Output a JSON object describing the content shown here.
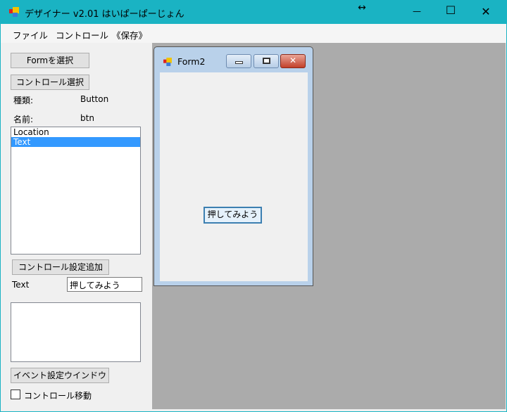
{
  "window": {
    "title": "デザイナー v2.01 はいぱーぱーじょん",
    "minimize": "—",
    "maximize": "☐",
    "close": "✕",
    "resize_indicator": "↔"
  },
  "menu": [
    "ファイル",
    "コントロール",
    "《保存》"
  ],
  "panel": {
    "select_form_button": "Formを選択",
    "select_control_button": "コントロール選択",
    "kind_label": "種類:",
    "kind_value": "Button",
    "name_label": "名前:",
    "name_value": "btn",
    "properties": [
      "Location",
      "Text"
    ],
    "selected_property": "Text",
    "add_setting_button": "コントロール設定追加",
    "text_label": "Text",
    "text_value": "押してみよう",
    "event_window_button": "イベント設定ウインドウ",
    "move_control_label": "コントロール移動",
    "move_control_checked": false
  },
  "form2": {
    "title": "Form2",
    "button_text": "押してみよう"
  }
}
